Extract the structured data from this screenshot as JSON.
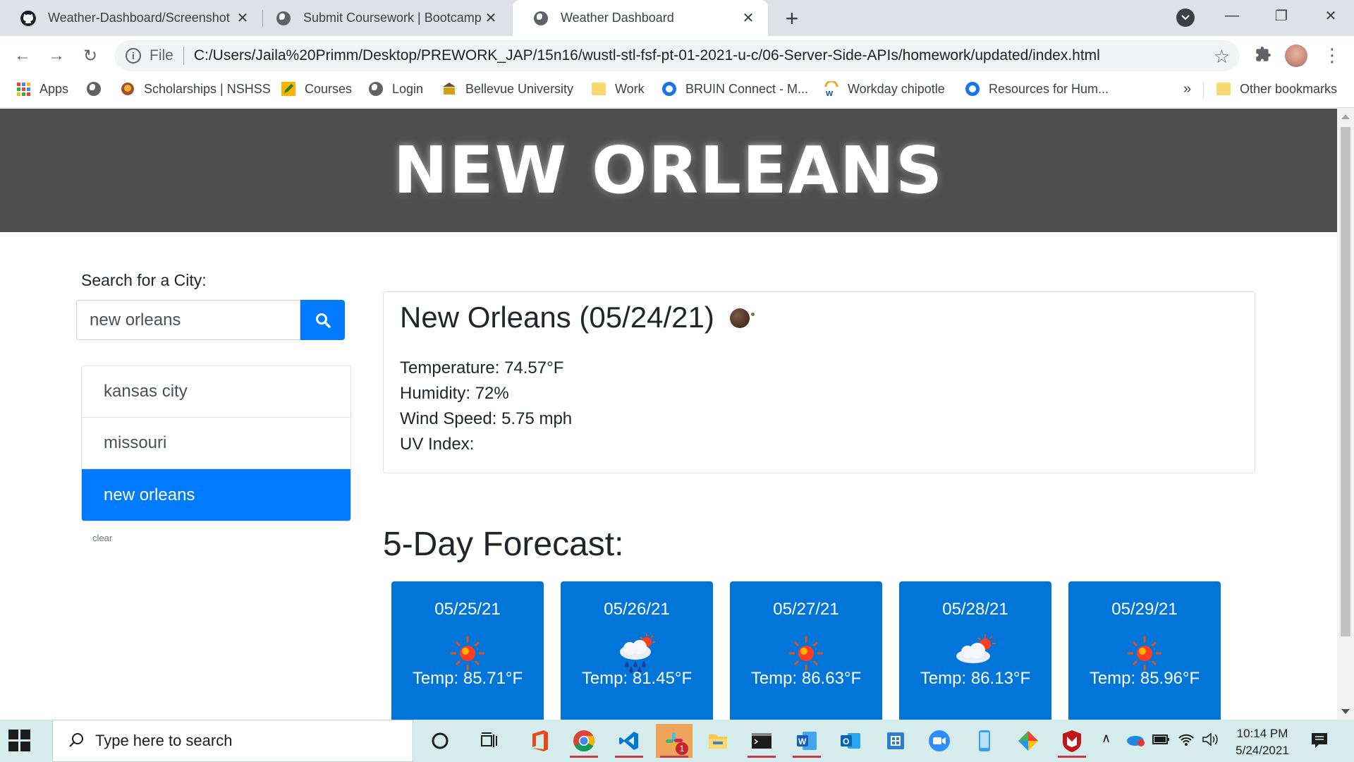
{
  "browser": {
    "tabs": [
      {
        "title": "Weather-Dashboard/Screenshot",
        "active": false
      },
      {
        "title": "Submit Coursework | Bootcamp S",
        "active": false
      },
      {
        "title": "Weather Dashboard",
        "active": true
      }
    ],
    "new_tab": "+",
    "scheme": "File",
    "url": "C:/Users/Jaila%20Primm/Desktop/PREWORK_JAP/15n16/wustl-stl-fsf-pt-01-2021-u-c/06-Server-Side-APIs/homework/updated/index.html",
    "bookmarks": [
      "Apps",
      "Scholarships | NSHSS",
      "Courses",
      "Login",
      "Bellevue University",
      "Work",
      "BRUIN Connect - M...",
      "Workday chipotle",
      "Resources for Hum..."
    ],
    "bookmarks_overflow": "»",
    "other_bookmarks": "Other bookmarks"
  },
  "page": {
    "hero_title": "NEW ORLEANS",
    "search_label": "Search for a City:",
    "search_value": "new orleans",
    "history": [
      "kansas city",
      "missouri",
      "new orleans"
    ],
    "active_history_index": 2,
    "clear_label": "clear",
    "current": {
      "title": "New Orleans (05/24/21)",
      "icon": "night-clear-moon-icon",
      "temperature": "Temperature: 74.57°F",
      "humidity": "Humidity: 72%",
      "wind": "Wind Speed: 5.75 mph",
      "uv": "UV Index:"
    },
    "forecast_heading": "5-Day Forecast:",
    "forecast": [
      {
        "date": "05/25/21",
        "icon": "sun-icon",
        "temp": "Temp: 85.71°F"
      },
      {
        "date": "05/26/21",
        "icon": "rain-cloud-sun-icon",
        "temp": "Temp: 81.45°F"
      },
      {
        "date": "05/27/21",
        "icon": "sun-icon",
        "temp": "Temp: 86.63°F"
      },
      {
        "date": "05/28/21",
        "icon": "cloud-sun-icon",
        "temp": "Temp: 86.13°F"
      },
      {
        "date": "05/29/21",
        "icon": "sun-icon",
        "temp": "Temp: 85.96°F"
      }
    ]
  },
  "taskbar": {
    "search_placeholder": "Type here to search",
    "time": "10:14 PM",
    "date": "5/24/2021",
    "slack_badge": "1"
  },
  "colors": {
    "primary": "#007bff",
    "forecast_card": "#0275d8",
    "hero_bg": "#4f4f4f"
  }
}
